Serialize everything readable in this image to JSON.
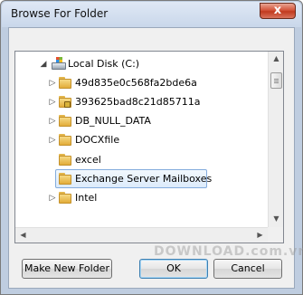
{
  "window": {
    "title": "Browse For Folder",
    "close_symbol": "x"
  },
  "tree": {
    "root": {
      "label": "Local Disk (C:)",
      "expander": "◢",
      "icon": "drive-icon"
    },
    "items": [
      {
        "label": "49d835e0c568fa2bde6a",
        "expander": "▷",
        "icon": "folder-icon",
        "locked": false
      },
      {
        "label": "393625bad8c21d85711a",
        "expander": "▷",
        "icon": "locked-folder-icon",
        "locked": true
      },
      {
        "label": "DB_NULL_DATA",
        "expander": "▷",
        "icon": "folder-icon",
        "locked": false
      },
      {
        "label": "DOCXfile",
        "expander": "▷",
        "icon": "folder-icon",
        "locked": false
      },
      {
        "label": "excel",
        "expander": "",
        "icon": "folder-icon",
        "locked": false
      },
      {
        "label": "Exchange Server Mailboxes",
        "expander": "",
        "icon": "folder-icon",
        "locked": false,
        "selected": true
      },
      {
        "label": "Intel",
        "expander": "▷",
        "icon": "folder-icon",
        "locked": false
      }
    ],
    "scroll_up": "▲",
    "scroll_down": "▼",
    "scroll_left": "◀",
    "scroll_right": "▶"
  },
  "buttons": {
    "make_new_folder": "Make New Folder",
    "ok": "OK",
    "cancel": "Cancel"
  },
  "watermark": "DOWNLOAD.com.vn"
}
